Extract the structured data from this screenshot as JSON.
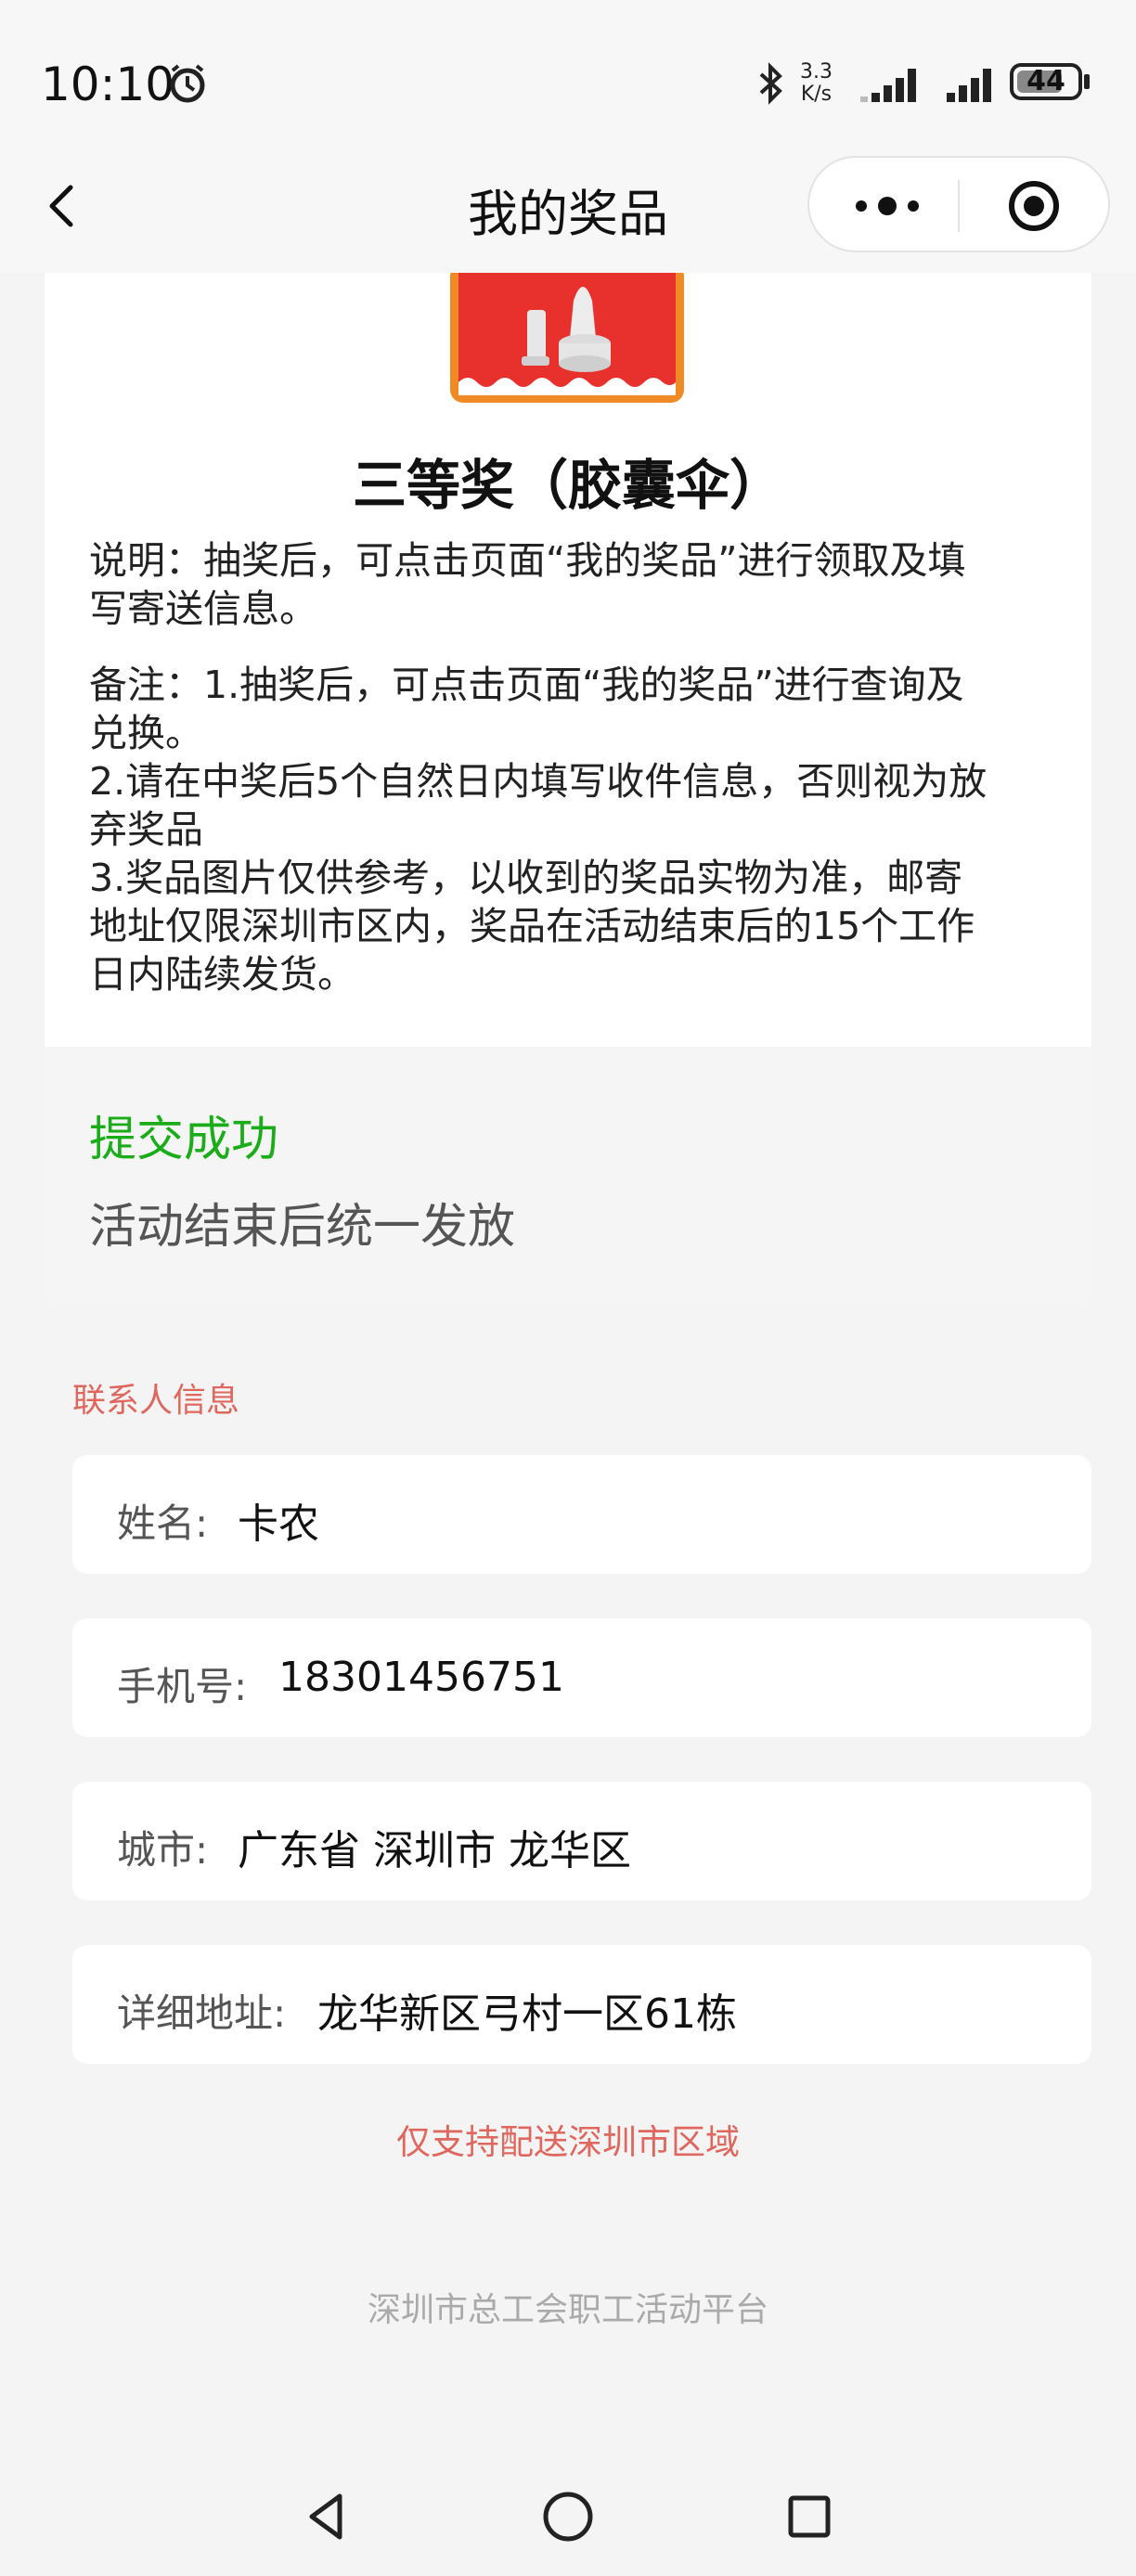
{
  "status_bar": {
    "time": "10:10",
    "net_speed_value": "3.3",
    "net_speed_unit": "K/s",
    "battery": "44",
    "icons": [
      "alarm-icon",
      "bluetooth-icon",
      "signal-icon",
      "signal-icon",
      "battery-icon"
    ]
  },
  "header": {
    "title": "我的奖品",
    "back_icon": "chevron-left-icon",
    "more_icon": "more-dots-icon",
    "close_icon": "target-circle-icon"
  },
  "prize": {
    "image_icon": "umbrella-prize-icon",
    "title": "三等奖（胶囊伞）",
    "description_lines": [
      "说明：抽奖后，可点击页面“我的奖品”进行领取及填",
      "写寄送信息。"
    ],
    "remark_lines": [
      "备注：1.抽奖后，可点击页面“我的奖品”进行查询及",
      "兑换。",
      "2.请在中奖后5个自然日内填写收件信息，否则视为放",
      "弃奖品",
      "3.奖品图片仅供参考，以收到的奖品实物为准，邮寄",
      "地址仅限深圳市区内，奖品在活动结束后的15个工作",
      "日内陆续发货。"
    ]
  },
  "submission": {
    "status": "提交成功",
    "note": "活动结束后统一发放",
    "status_color": "#1aad19"
  },
  "contact": {
    "section_label": "联系人信息",
    "fields": [
      {
        "label": "姓名:",
        "value": "卡农"
      },
      {
        "label": "手机号:",
        "value": "18301456751"
      },
      {
        "label": "城市:",
        "value": "广东省 深圳市 龙华区"
      },
      {
        "label": "详细地址:",
        "value": "龙华新区弓村一区61栋"
      }
    ]
  },
  "delivery_note": "仅支持配送深圳市区域",
  "footer": "深圳市总工会职工活动平台",
  "system_nav": [
    "back-triangle-icon",
    "home-circle-icon",
    "recents-square-icon"
  ],
  "colors": {
    "accent_red": "#e0675e",
    "success_green": "#1aad19",
    "background": "#f4f4f4"
  }
}
